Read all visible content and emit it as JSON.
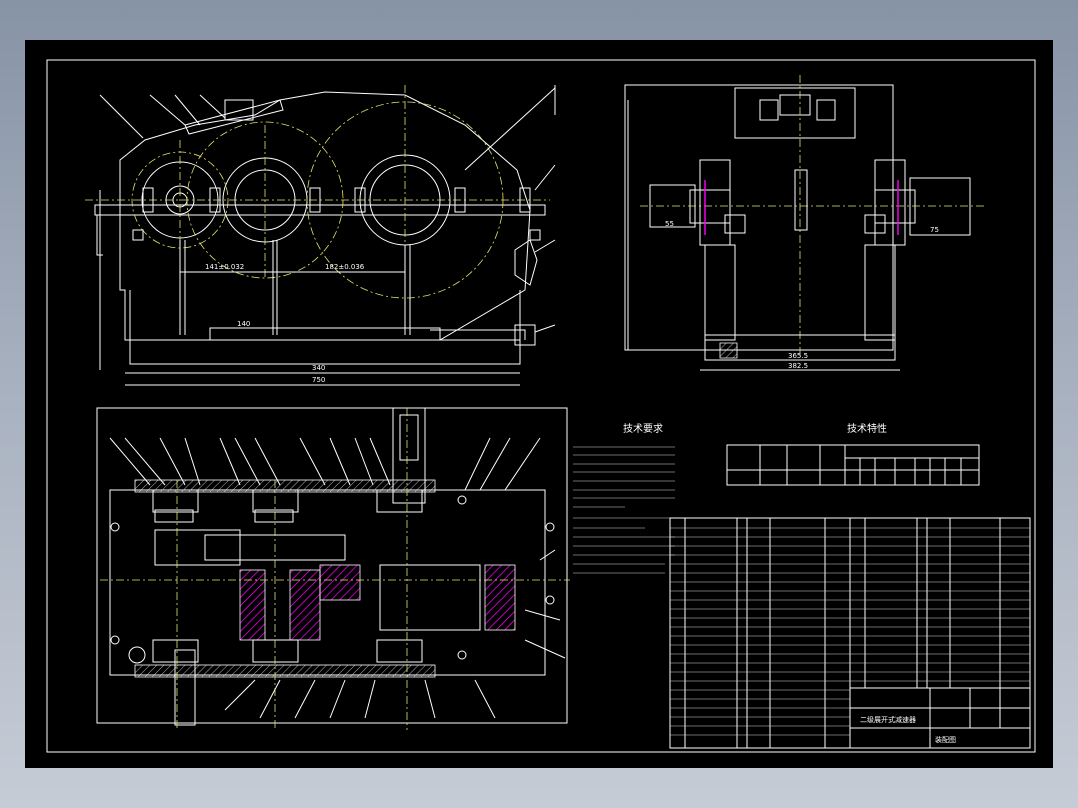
{
  "drawing": {
    "title_tech_requirements": "技术要求",
    "title_tech_characteristics": "技术特性",
    "title_block_name": "二级展开式减速器",
    "title_block_subtitle": "装配图",
    "colors": {
      "background": "#000000",
      "lines": "#ffffff",
      "center_lines": "#e6e36a",
      "hatch": "#ff00ff",
      "window_frame": "#8793a6"
    }
  },
  "dimensions": {
    "front_a": "141±0.032",
    "front_b": "182±0.036",
    "front_c": "340",
    "front_d": "750",
    "front_e": "140",
    "side_a": "365.5",
    "side_b": "382.5",
    "side_c": "55",
    "side_d": "75"
  }
}
